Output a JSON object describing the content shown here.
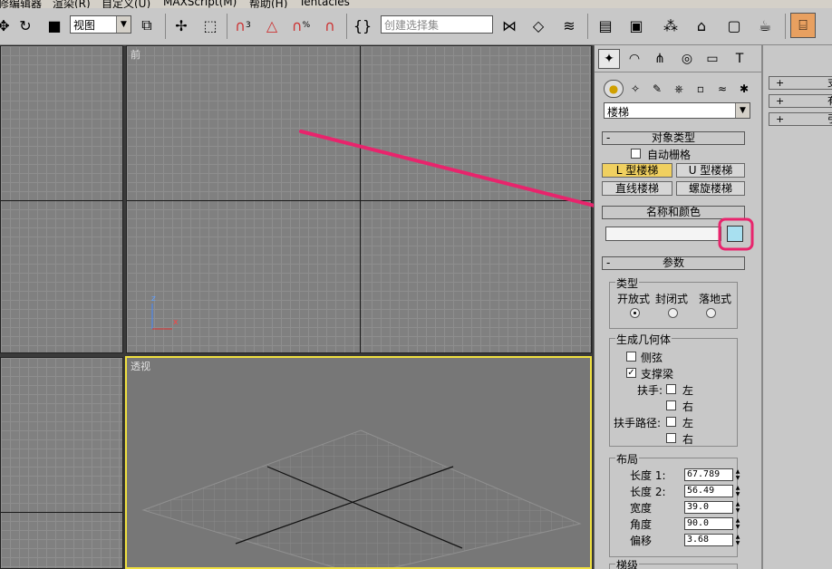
{
  "menubar": {
    "items": [
      "修编辑器",
      "渲染(R)",
      "自定义(U)",
      "MAXScript(M)",
      "帮助(H)",
      "Tentacles"
    ]
  },
  "toolbar": {
    "view_select": "视图",
    "selection_set_placeholder": "创建选择集",
    "snap_label": "3"
  },
  "viewports": {
    "front_label": "前",
    "persp_label": "透视",
    "axis_z": "z",
    "axis_x": "x"
  },
  "command_panel": {
    "category_select": "楼梯",
    "object_type": {
      "title": "对象类型",
      "autogrid": "自动栅格",
      "buttons": [
        "L 型楼梯",
        "U 型楼梯",
        "直线楼梯",
        "螺旋楼梯"
      ],
      "active_button": "L 型楼梯"
    },
    "name_color": {
      "title": "名称和颜色",
      "name_value": "",
      "color": "#a8e0f0"
    },
    "parameters": {
      "title": "参数",
      "type_group": {
        "title": "类型",
        "options": [
          "开放式",
          "封闭式",
          "落地式"
        ],
        "selected": "开放式"
      },
      "geometry_group": {
        "title": "生成几何体",
        "stringers": "侧弦",
        "carriage": "支撑梁",
        "handrail": "扶手:",
        "handrail_path": "扶手路径:",
        "left": "左",
        "right": "右"
      },
      "layout_group": {
        "title": "布局",
        "length1_label": "长度 1:",
        "length1_value": "67.789",
        "length2_label": "长度 2:",
        "length2_value": "56.49",
        "width_label": "宽度",
        "width_value": "39.0",
        "angle_label": "角度",
        "angle_value": "90.0",
        "offset_label": "偏移",
        "offset_value": "3.68"
      },
      "steps_title": "梯级"
    }
  },
  "right_panel": {
    "rows": [
      "支",
      "有",
      "引"
    ]
  },
  "colors": {
    "accent_arrow": "#e8246c",
    "active_viewport_border": "#f0e040",
    "active_button": "#f0d060"
  }
}
